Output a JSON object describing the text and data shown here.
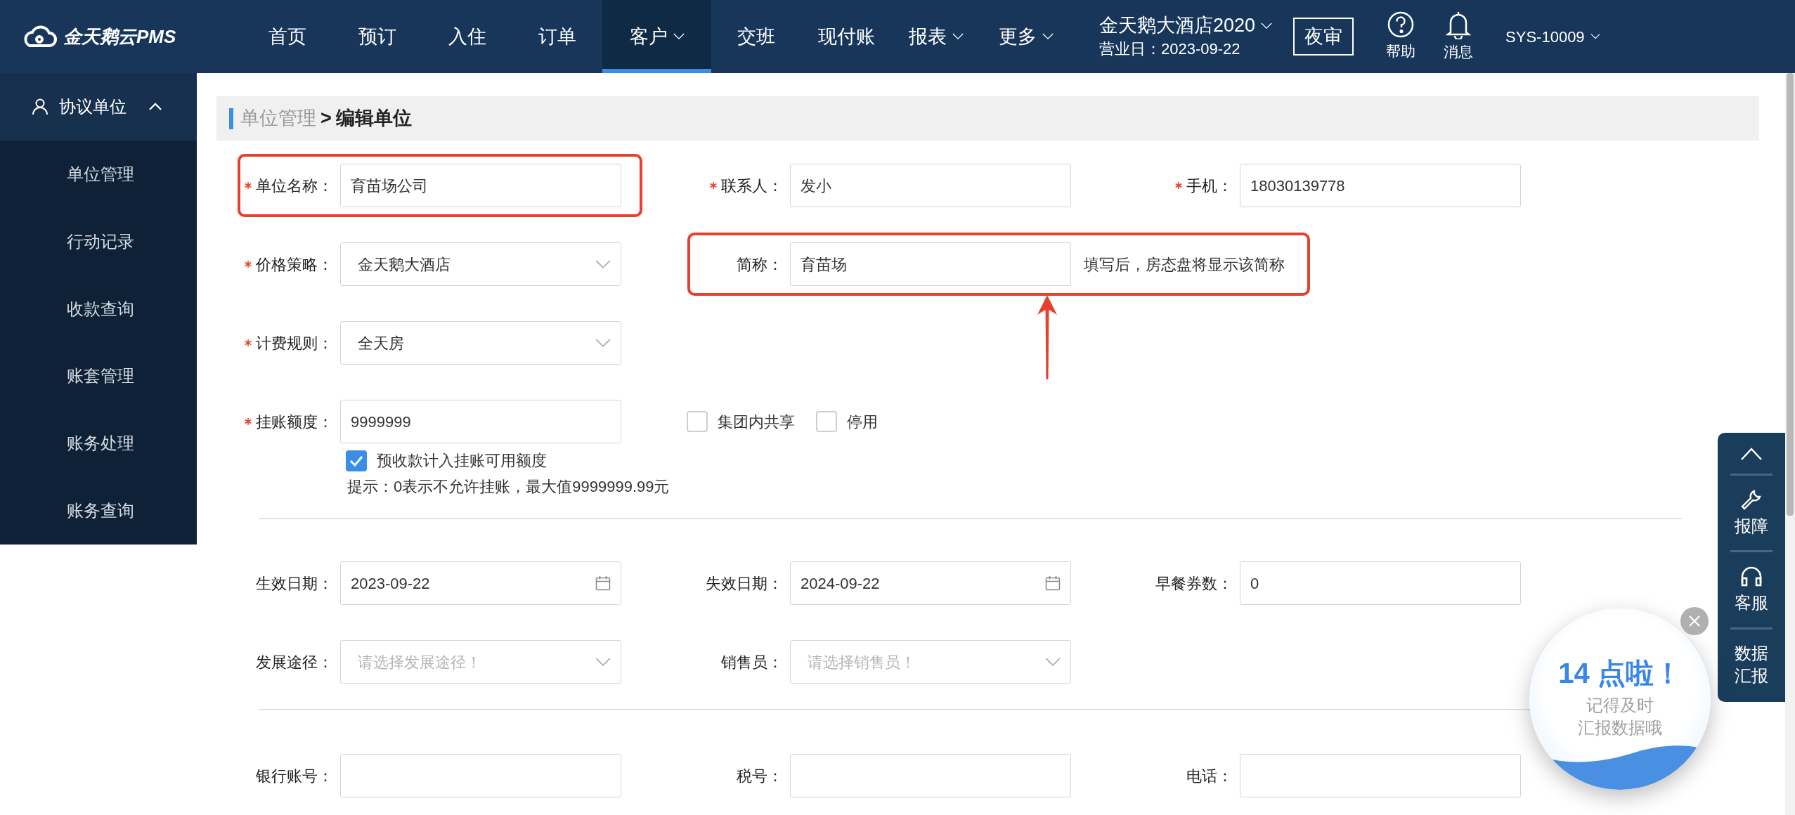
{
  "header": {
    "logo": "金天鹅云PMS",
    "nav": [
      {
        "label": "首页",
        "selected": false,
        "dropdown": false
      },
      {
        "label": "预订",
        "selected": false,
        "dropdown": false
      },
      {
        "label": "入住",
        "selected": false,
        "dropdown": false
      },
      {
        "label": "订单",
        "selected": false,
        "dropdown": false
      },
      {
        "label": "客户",
        "selected": true,
        "dropdown": true
      },
      {
        "label": "交班",
        "selected": false,
        "dropdown": false
      },
      {
        "label": "现付账",
        "selected": false,
        "dropdown": false
      },
      {
        "label": "报表",
        "selected": false,
        "dropdown": true
      },
      {
        "label": "更多",
        "selected": false,
        "dropdown": true
      }
    ],
    "hotel": "金天鹅大酒店2020",
    "business_date": "营业日：2023-09-22",
    "night_audit": "夜审",
    "help": "帮助",
    "messages": "消息",
    "user": "SYS-10009"
  },
  "sidebar": {
    "group": {
      "label": "协议单位",
      "expanded": true
    },
    "items": [
      {
        "label": "单位管理"
      },
      {
        "label": "行动记录"
      },
      {
        "label": "收款查询"
      },
      {
        "label": "账套管理"
      },
      {
        "label": "账务处理"
      },
      {
        "label": "账务查询"
      }
    ]
  },
  "breadcrumb": {
    "parent": "单位管理",
    "separator": ">",
    "current": "编辑单位"
  },
  "sections": [
    {
      "rows": [
        {
          "fields": [
            {
              "label": "单位名称：",
              "required": true,
              "kind": "text",
              "value": "育苗场公司",
              "highlighted": true
            },
            {
              "label": "联系人：",
              "required": true,
              "kind": "text",
              "value": "发小"
            },
            {
              "label": "手机：",
              "required": true,
              "kind": "text",
              "value": "18030139778"
            }
          ]
        },
        {
          "fields": [
            {
              "label": "价格策略：",
              "required": true,
              "kind": "select",
              "value": "金天鹅大酒店"
            },
            {
              "label": "简称：",
              "required": false,
              "kind": "text",
              "value": "育苗场",
              "hint": "填写后，房态盘将显示该简称",
              "highlighted": true,
              "arrow": true
            }
          ]
        },
        {
          "fields": [
            {
              "label": "计费规则：",
              "required": true,
              "kind": "select",
              "value": "全天房"
            }
          ]
        },
        {
          "fields": [
            {
              "label": "挂账额度：",
              "required": true,
              "kind": "text",
              "value": "9999999",
              "below": {
                "checkbox": {
                  "label": "预收款计入挂账可用额度",
                  "checked": true
                },
                "note": "提示：0表示不允许挂账，最大值9999999.99元"
              }
            }
          ],
          "checkboxes": [
            {
              "label": "集团内共享",
              "checked": false
            },
            {
              "label": "停用",
              "checked": false
            }
          ]
        }
      ]
    },
    {
      "rows": [
        {
          "fields": [
            {
              "label": "生效日期：",
              "required": false,
              "kind": "date",
              "value": "2023-09-22"
            },
            {
              "label": "失效日期：",
              "required": false,
              "kind": "date",
              "value": "2024-09-22"
            },
            {
              "label": "早餐券数：",
              "required": false,
              "kind": "text",
              "value": "0"
            }
          ]
        },
        {
          "fields": [
            {
              "label": "发展途径：",
              "required": false,
              "kind": "select",
              "placeholder": "请选择发展途径！"
            },
            {
              "label": "销售员：",
              "required": false,
              "kind": "select",
              "placeholder": "请选择销售员！"
            }
          ]
        }
      ]
    },
    {
      "rows": [
        {
          "fields": [
            {
              "label": "银行账号：",
              "required": false,
              "kind": "text"
            },
            {
              "label": "税号：",
              "required": false,
              "kind": "text"
            },
            {
              "label": "电话：",
              "required": false,
              "kind": "text"
            }
          ]
        }
      ]
    }
  ],
  "side_panel": [
    {
      "kind": "top"
    },
    {
      "kind": "report",
      "label": "报障"
    },
    {
      "kind": "service",
      "label": "客服"
    },
    {
      "kind": "data",
      "label": "数据汇报"
    }
  ],
  "reminder": {
    "title": "14 点啦！",
    "message_lines": [
      "记得及时",
      "汇报数据哦"
    ]
  }
}
